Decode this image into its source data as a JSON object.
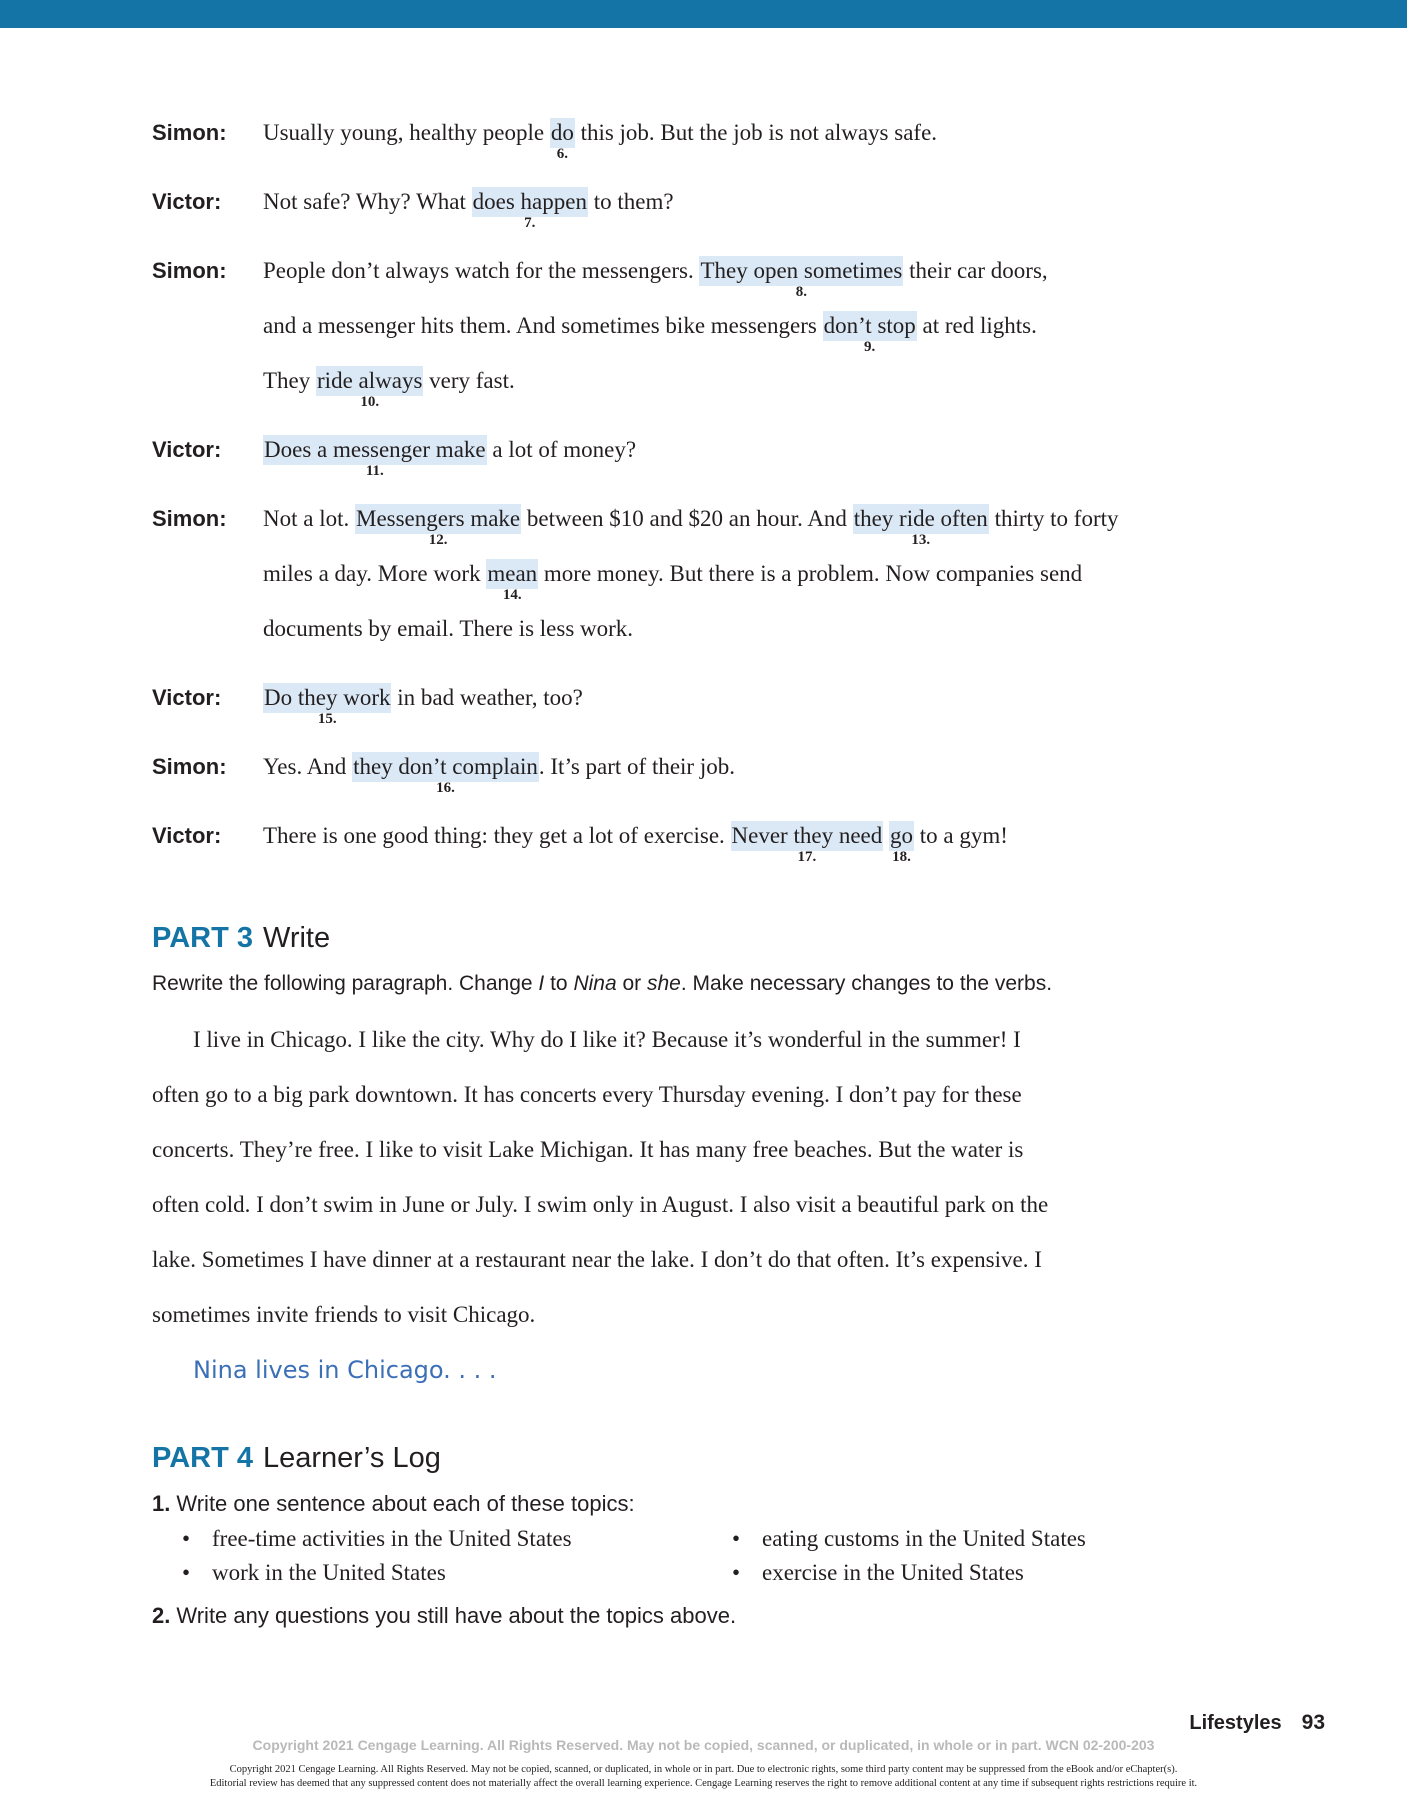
{
  "dialogue": [
    {
      "speaker": "Simon:",
      "lines": [
        [
          {
            "t": "Usually young, healthy people "
          },
          {
            "t": "do",
            "hl": true,
            "n": "6."
          },
          {
            "t": " this job. But the job is not always safe."
          }
        ]
      ]
    },
    {
      "speaker": "Victor:",
      "lines": [
        [
          {
            "t": "Not safe? Why? What "
          },
          {
            "t": "does happen",
            "hl": true,
            "n": "7."
          },
          {
            "t": " to them?"
          }
        ]
      ]
    },
    {
      "speaker": "Simon:",
      "lines": [
        [
          {
            "t": "People don’t always watch for the messengers. "
          },
          {
            "t": "They open sometimes",
            "hl": true,
            "n": "8."
          },
          {
            "t": " their car doors,"
          }
        ],
        [
          {
            "t": "and a messenger hits them. And sometimes bike messengers "
          },
          {
            "t": "don’t stop",
            "hl": true,
            "n": "9."
          },
          {
            "t": " at red lights."
          }
        ],
        [
          {
            "t": "They "
          },
          {
            "t": "ride always",
            "hl": true,
            "n": "10."
          },
          {
            "t": " very fast."
          }
        ]
      ]
    },
    {
      "speaker": "Victor:",
      "lines": [
        [
          {
            "t": "Does a messenger make",
            "hl": true,
            "n": "11."
          },
          {
            "t": " a lot of money?"
          }
        ]
      ]
    },
    {
      "speaker": "Simon:",
      "lines": [
        [
          {
            "t": "Not a lot. "
          },
          {
            "t": "Messengers make",
            "hl": true,
            "n": "12."
          },
          {
            "t": " between $10 and $20 an hour. And "
          },
          {
            "t": "they ride often",
            "hl": true,
            "n": "13."
          },
          {
            "t": " thirty to forty"
          }
        ],
        [
          {
            "t": "miles a day. More work "
          },
          {
            "t": "mean",
            "hl": true,
            "n": "14."
          },
          {
            "t": " more money. But there is a problem. Now companies send"
          }
        ],
        [
          {
            "t": "documents by email. There is less work."
          }
        ]
      ]
    },
    {
      "speaker": "Victor:",
      "lines": [
        [
          {
            "t": "Do they work",
            "hl": true,
            "n": "15."
          },
          {
            "t": " in bad weather, too?"
          }
        ]
      ]
    },
    {
      "speaker": "Simon:",
      "lines": [
        [
          {
            "t": "Yes. And "
          },
          {
            "t": "they don’t complain",
            "hl": true,
            "n": "16."
          },
          {
            "t": ". It’s part of their job."
          }
        ]
      ]
    },
    {
      "speaker": "Victor:",
      "lines": [
        [
          {
            "t": "There is one good thing: they get a lot of exercise. "
          },
          {
            "t": "Never they need",
            "hl": true,
            "n": "17."
          },
          {
            "t": " "
          },
          {
            "t": "go",
            "hl": true,
            "n": "18."
          },
          {
            "t": " to a gym!"
          }
        ]
      ]
    }
  ],
  "part3": {
    "number": "PART 3",
    "title": "Write",
    "instr_a": "Rewrite the following paragraph. Change ",
    "instr_i": "I",
    "instr_b": " to ",
    "instr_nina": "Nina",
    "instr_c": " or ",
    "instr_she": "she",
    "instr_d": ". Make necessary changes to the verbs.",
    "paragraph": [
      "I live in Chicago. I like the city. Why do I like it? Because it’s wonderful in the summer! I",
      "often go to a big park downtown. It has concerts every Thursday evening. I don’t pay for these",
      "concerts. They’re free. I like to visit Lake Michigan. It has many free beaches. But the water is",
      "often cold. I don’t swim in June or July. I swim only in August. I also visit a beautiful park on the",
      "lake. Sometimes I have dinner at a restaurant near the lake. I don’t do that often. It’s expensive. I",
      "sometimes invite friends to visit Chicago."
    ],
    "answer": "Nina lives in Chicago. . . ."
  },
  "part4": {
    "number": "PART 4",
    "title": "Learner’s Log",
    "item1_num": "1.",
    "item1_text": "Write one sentence about each of these topics:",
    "bullets": [
      "free-time activities in the United States",
      "eating customs in the United States",
      "work in the United States",
      "exercise in the United States"
    ],
    "bullet_char": "•",
    "item2_num": "2.",
    "item2_text": "Write any questions you still have about the topics above."
  },
  "footer": {
    "section": "Lifestyles",
    "page": "93",
    "copyright_main": "Copyright 2021 Cengage Learning. All Rights Reserved. May not be copied, scanned, or duplicated, in whole or in part.  WCN 02-200-203",
    "copyright_line1": "Copyright 2021 Cengage Learning. All Rights Reserved. May not be copied, scanned, or duplicated, in whole or in part. Due to electronic rights, some third party content may be suppressed from the eBook and/or eChapter(s).",
    "copyright_line2": "Editorial review has deemed that any suppressed content does not materially affect the overall learning experience. Cengage Learning reserves the right to remove additional content at any time if subsequent rights restrictions require it."
  },
  "colors": {
    "accent": "#1474a6",
    "highlight": "#dbe9f6",
    "handwriting": "#3b6fb6"
  }
}
